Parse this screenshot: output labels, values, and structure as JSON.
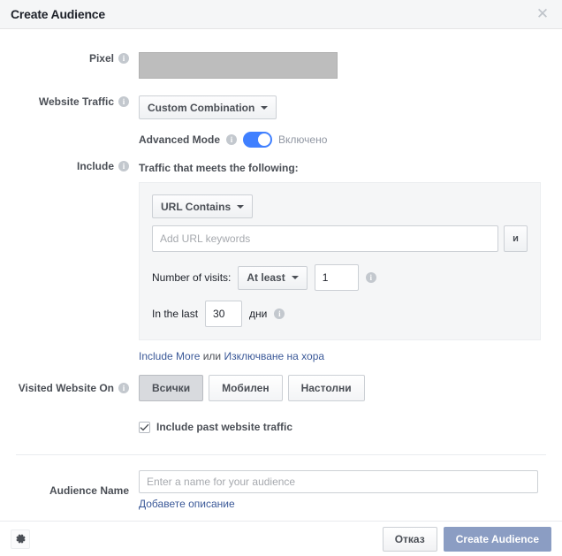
{
  "header": {
    "title": "Create Audience",
    "close_icon": "close-icon"
  },
  "form": {
    "pixel": {
      "label": "Pixel",
      "info_icon": "info-icon",
      "value": ""
    },
    "website_traffic": {
      "label": "Website Traffic",
      "info_icon": "info-icon",
      "selected": "Custom Combination"
    },
    "advanced_mode": {
      "label": "Advanced Mode",
      "info_icon": "info-icon",
      "state_text": "Включено",
      "enabled": true,
      "accent_color": "#4080ff"
    },
    "include": {
      "label": "Include",
      "info_icon": "info-icon",
      "heading": "Traffic that meets the following:",
      "rule": {
        "condition_selected": "URL Contains",
        "url_placeholder": "Add URL keywords",
        "url_value": "",
        "and_button": "и",
        "visits_label": "Number of visits:",
        "visits_operator": "At least",
        "visits_value": "1",
        "visits_info_icon": "info-icon",
        "in_the_last_label": "In the last",
        "days_value": "30",
        "days_unit": "дни",
        "days_info_icon": "info-icon"
      },
      "links": {
        "include_more": "Include More",
        "separator": "или",
        "exclude_people": "Изключване на хора"
      }
    },
    "visited_website_on": {
      "label": "Visited Website On",
      "info_icon": "info-icon",
      "options": [
        "Всички",
        "Мобилен",
        "Настолни"
      ],
      "selected_index": 0
    },
    "include_past_traffic": {
      "label": "Include past website traffic",
      "checked": true
    },
    "audience_name": {
      "label": "Audience Name",
      "placeholder": "Enter a name for your audience",
      "value": "",
      "add_description_link": "Добавете описание"
    }
  },
  "footer": {
    "gear_icon": "gear-icon",
    "cancel_label": "Отказ",
    "submit_label": "Create Audience",
    "submit_color": "#8b9dc3"
  }
}
